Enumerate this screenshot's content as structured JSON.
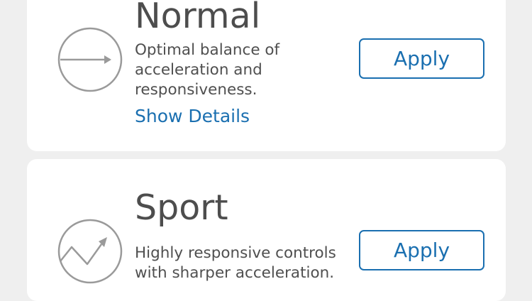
{
  "modes": [
    {
      "title": "Normal",
      "description_lines": [
        "Optimal balance of",
        "acceleration and",
        "responsiveness."
      ],
      "details_label": "Show Details",
      "apply_label": "Apply",
      "icon": "arrow-right-icon"
    },
    {
      "title": "Sport",
      "description_lines": [
        "Highly responsive controls",
        "with sharper acceleration."
      ],
      "apply_label": "Apply",
      "icon": "zigzag-arrow-up-icon"
    }
  ],
  "colors": {
    "accent": "#1a6fb0",
    "background": "#efefef",
    "card": "#ffffff",
    "title_text": "#4d4d4d",
    "body_text": "#4f4f4f",
    "icon_stroke": "#9a9a9a"
  }
}
